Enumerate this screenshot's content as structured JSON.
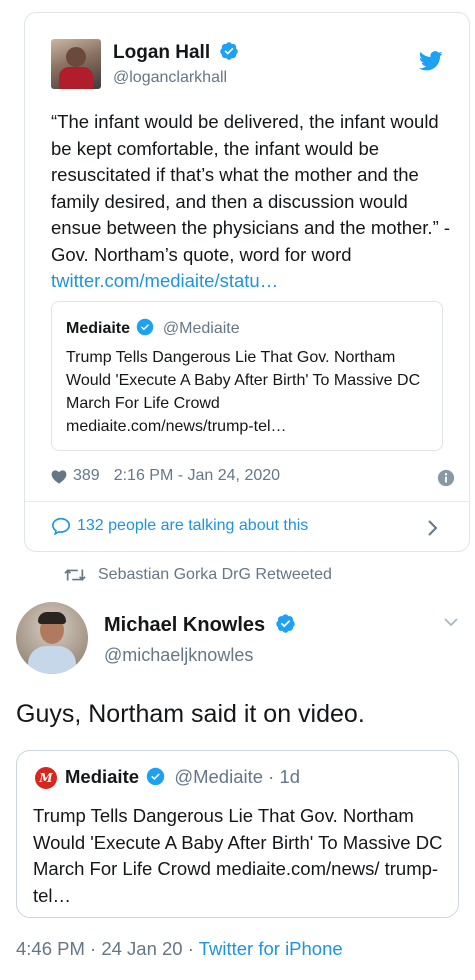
{
  "embedded_tweet": {
    "name": "Logan Hall",
    "handle": "@loganclarkhall",
    "text": "“The infant would be delivered, the infant would be kept comfortable, the infant would be resuscitated if that’s what the mother and the family desired, and then a discussion would ensue between the physicians and the mother.” - Gov. Northam’s quote, word for word ",
    "link_text": "twitter.com/mediaite/statu…",
    "quoted": {
      "name": "Mediaite",
      "handle": "@Mediaite",
      "text": "Trump Tells Dangerous Lie That Gov. Northam Would 'Execute A Baby After Birth' To Massive DC March For Life Crowd",
      "link": "mediaite.com/news/trump-tel…"
    },
    "likes": "389",
    "timestamp": "2:16 PM - Jan 24, 2020",
    "talking": "132 people are talking about this"
  },
  "retweet_context": "Sebastian Gorka DrG Retweeted",
  "main_tweet": {
    "name": "Michael Knowles",
    "handle": "@michaeljknowles",
    "text": "Guys, Northam said it on video.",
    "quoted": {
      "logo_letter": "M",
      "name": "Mediaite",
      "handle": "@Mediaite · 1d",
      "text": "Trump Tells Dangerous Lie That Gov. Northam Would 'Execute A Baby After Birth' To Massive DC March For Life Crowd mediaite.com/news/ trump-tel…"
    },
    "time": "4:46 PM · 24 Jan 20 · ",
    "source": "Twitter for iPhone"
  },
  "colors": {
    "twitter_blue": "#1b95e0",
    "secondary_text": "#657786",
    "border": "#dfe4e8",
    "mediaite_red": "#d7261e"
  },
  "icons": [
    "verified-badge-icon",
    "twitter-bird-icon",
    "heart-icon",
    "info-icon",
    "speech-bubble-icon",
    "chevron-right-icon",
    "retweet-icon",
    "chevron-down-icon"
  ]
}
